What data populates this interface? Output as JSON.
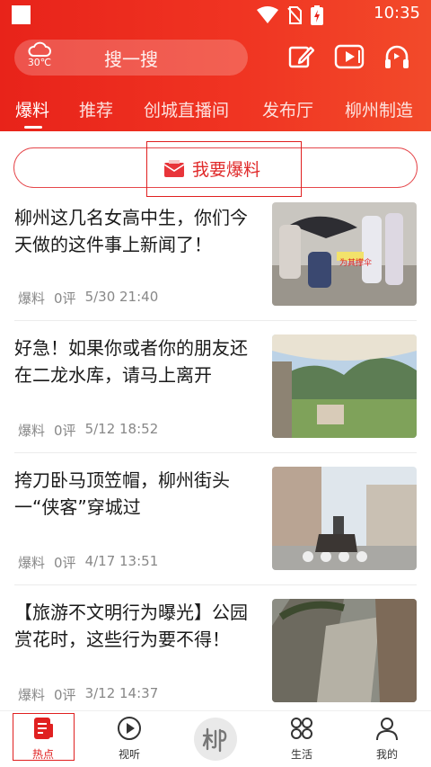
{
  "status_bar": {
    "time": "10:35"
  },
  "weather": {
    "temp": "30℃",
    "icon": "cloud-icon"
  },
  "search": {
    "placeholder": "搜一搜"
  },
  "header_icons": [
    "edit-icon",
    "video-icon",
    "headset-icon"
  ],
  "tabs": [
    {
      "label": "爆料",
      "active": true
    },
    {
      "label": "推荐",
      "active": false
    },
    {
      "label": "创城直播间",
      "active": false
    },
    {
      "label": "发布厅",
      "active": false
    },
    {
      "label": "柳州制造",
      "active": false
    }
  ],
  "report_button": {
    "label": "我要爆料",
    "icon": "envelope-icon"
  },
  "news": [
    {
      "title": "柳州这几名女高中生，你们今天做的这件事上新闻了！",
      "tag": "爆料",
      "comments": "0评",
      "time": "5/30 21:40",
      "thumb_text": "为其撑伞"
    },
    {
      "title": "好急！如果你或者你的朋友还在二龙水库，请马上离开",
      "tag": "爆料",
      "comments": "0评",
      "time": "5/12 18:52"
    },
    {
      "title": "挎刀卧马顶笠帽，柳州街头一“侠客”穿城过",
      "tag": "爆料",
      "comments": "0评",
      "time": "4/17 13:51"
    },
    {
      "title": "【旅游不文明行为曝光】公园赏花时，这些行为要不得！",
      "tag": "爆料",
      "comments": "0评",
      "time": "3/12 14:37"
    }
  ],
  "bottom_nav": [
    {
      "label": "热点",
      "icon": "hot-news-icon",
      "active": true
    },
    {
      "label": "视听",
      "icon": "play-circle-icon",
      "active": false
    },
    {
      "label": "",
      "icon": "liu-logo-icon",
      "active": false
    },
    {
      "label": "生活",
      "icon": "grid-icon",
      "active": false
    },
    {
      "label": "我的",
      "icon": "user-icon",
      "active": false
    }
  ],
  "colors": {
    "brand_red": "#e8231a",
    "accent_red": "#e02020",
    "meta_gray": "#888888"
  }
}
